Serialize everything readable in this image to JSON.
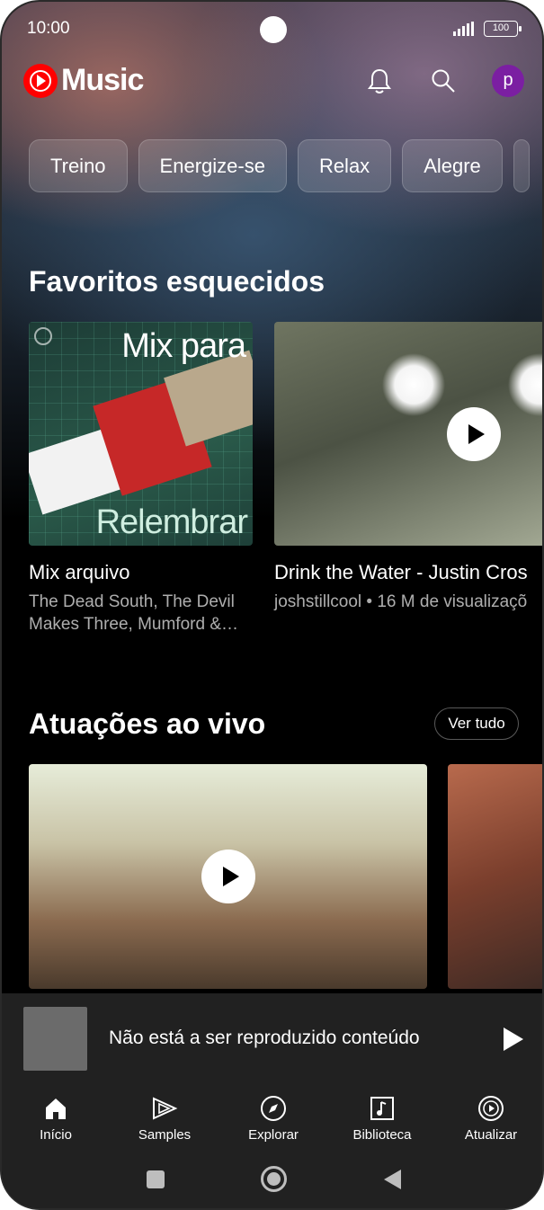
{
  "status_bar": {
    "time": "10:00",
    "battery": "100"
  },
  "header": {
    "app_name": "Music",
    "avatar_letter": "p"
  },
  "chips": [
    "Treino",
    "Energize-se",
    "Relax",
    "Alegre"
  ],
  "sections": {
    "favorites": {
      "title": "Favoritos esquecidos",
      "cards": [
        {
          "art_top": "Mix para",
          "art_bottom": "Relembrar",
          "title": "Mix arquivo",
          "subtitle": "The Dead South, The Devil Makes Three, Mumford &…"
        },
        {
          "title": "Drink the Water - Justin Cros",
          "subtitle": "joshstillcool • 16 M de visualizaçõ"
        }
      ]
    },
    "live": {
      "title": "Atuações ao vivo",
      "see_all": "Ver tudo"
    }
  },
  "miniplayer": {
    "text": "Não está a ser reproduzido conteúdo"
  },
  "bottom_nav": [
    {
      "label": "Início",
      "icon": "home-icon"
    },
    {
      "label": "Samples",
      "icon": "samples-icon"
    },
    {
      "label": "Explorar",
      "icon": "compass-icon"
    },
    {
      "label": "Biblioteca",
      "icon": "library-icon"
    },
    {
      "label": "Atualizar",
      "icon": "upgrade-icon"
    }
  ],
  "colors": {
    "brand_red": "#ff0000",
    "avatar_purple": "#7b1fa2",
    "bar_bg": "#212121"
  }
}
